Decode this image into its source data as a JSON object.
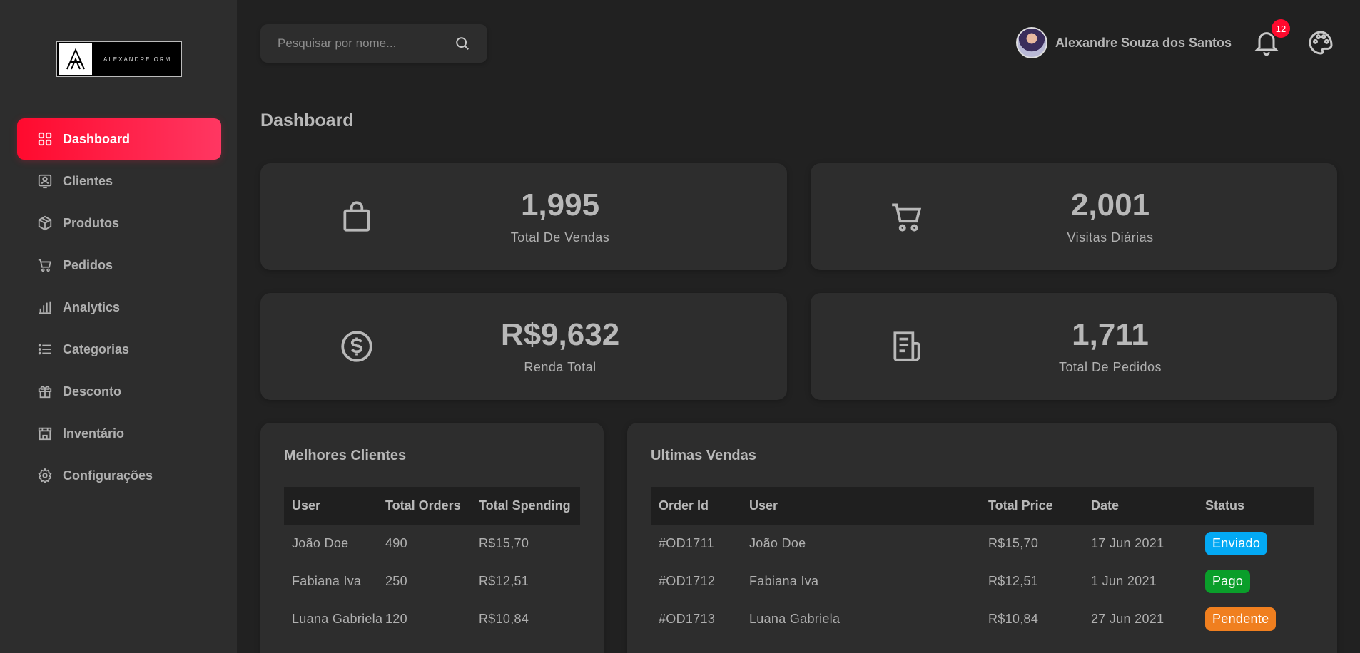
{
  "brand": {
    "logo_text": "ALEXANDRE ORM"
  },
  "sidebar": {
    "items": [
      {
        "label": "Dashboard",
        "icon": "grid-icon",
        "active": true
      },
      {
        "label": "Clientes",
        "icon": "user-card-icon",
        "active": false
      },
      {
        "label": "Produtos",
        "icon": "box-icon",
        "active": false
      },
      {
        "label": "Pedidos",
        "icon": "cart-icon",
        "active": false
      },
      {
        "label": "Analytics",
        "icon": "bar-chart-icon",
        "active": false
      },
      {
        "label": "Categorias",
        "icon": "list-icon",
        "active": false
      },
      {
        "label": "Desconto",
        "icon": "gift-icon",
        "active": false
      },
      {
        "label": "Inventário",
        "icon": "store-icon",
        "active": false
      },
      {
        "label": "Configurações",
        "icon": "gear-icon",
        "active": false
      }
    ]
  },
  "search": {
    "placeholder": "Pesquisar por nome..."
  },
  "user": {
    "name": "Alexandre Souza dos Santos"
  },
  "notifications": {
    "count": "12"
  },
  "page": {
    "title": "Dashboard"
  },
  "stats": [
    {
      "value": "1,995",
      "label": "Total De Vendas",
      "icon": "shopping-bag-icon"
    },
    {
      "value": "2,001",
      "label": "Visitas Diárias",
      "icon": "cart-icon"
    },
    {
      "value": "R$9,632",
      "label": "Renda Total",
      "icon": "dollar-circle-icon"
    },
    {
      "value": "1,711",
      "label": "Total De Pedidos",
      "icon": "receipt-icon"
    }
  ],
  "top_customers": {
    "title": "Melhores Clientes",
    "columns": [
      "User",
      "Total Orders",
      "Total Spending"
    ],
    "rows": [
      [
        "João Doe",
        "490",
        "R$15,70"
      ],
      [
        "Fabiana Iva",
        "250",
        "R$12,51"
      ],
      [
        "Luana Gabriela",
        "120",
        "R$10,84"
      ]
    ]
  },
  "latest_sales": {
    "title": "Ultimas Vendas",
    "columns": [
      "Order Id",
      "User",
      "Total Price",
      "Date",
      "Status"
    ],
    "rows": [
      [
        "#OD1711",
        "João Doe",
        "R$15,70",
        "17 Jun 2021",
        "Enviado"
      ],
      [
        "#OD1712",
        "Fabiana Iva",
        "R$12,51",
        "1 Jun 2021",
        "Pago"
      ],
      [
        "#OD1713",
        "Luana Gabriela",
        "R$10,84",
        "27 Jun 2021",
        "Pendente"
      ]
    ]
  },
  "colors": {
    "accent": "#ff0a2e",
    "status_enviado": "#03a9f4",
    "status_pago": "#0a9e2a",
    "status_pendente": "#f07f1f"
  }
}
